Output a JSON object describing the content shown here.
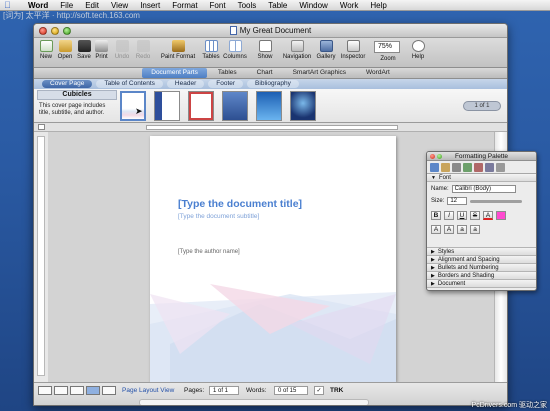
{
  "menubar": {
    "items": [
      "Word",
      "File",
      "Edit",
      "View",
      "Insert",
      "Format",
      "Font",
      "Tools",
      "Table",
      "Window",
      "Work",
      "Help"
    ]
  },
  "window": {
    "title": "My Great Document"
  },
  "toolbar": {
    "new": "New",
    "open": "Open",
    "save": "Save",
    "print": "Print",
    "undo": "Undo",
    "redo": "Redo",
    "paint_format": "Paint Format",
    "tables": "Tables",
    "columns": "Columns",
    "show": "Show",
    "navigation": "Navigation",
    "gallery": "Gallery",
    "inspector": "Inspector",
    "zoom": "Zoom",
    "zoom_value": "75%",
    "help": "Help"
  },
  "ribbon": {
    "tabs": [
      "Document Parts",
      "Tables",
      "Chart",
      "SmartArt Graphics",
      "WordArt"
    ],
    "active": 0
  },
  "gallery": {
    "tabs": [
      "Cover Page",
      "Table of Contents",
      "Header",
      "Footer",
      "Bibliography"
    ],
    "active": 0,
    "selected_title": "Cubicles",
    "selected_desc": "This cover page includes title, subtitle, and author.",
    "pager": "1 of 1"
  },
  "document": {
    "title_placeholder": "[Type the document title]",
    "subtitle_placeholder": "[Type the document subtitle]",
    "author_placeholder": "[Type the author name]"
  },
  "status": {
    "view": "Page Layout View",
    "pages_label": "Pages:",
    "pages_value": "1 of 1",
    "words_label": "Words:",
    "words_value": "0 of 15",
    "trk": "TRK"
  },
  "palette": {
    "title": "Formatting Palette",
    "font_section": "Font",
    "name_label": "Name:",
    "name_value": "Calibri (Body)",
    "size_label": "Size:",
    "size_value": "12",
    "sections": [
      "Styles",
      "Alignment and Spacing",
      "Bullets and Numbering",
      "Borders and Shading",
      "Document"
    ]
  },
  "overlays": {
    "top_watermark": "[词为] 太平洋  ·  http://soft.tech.163.com",
    "bottom_watermark": "PcDrivers.com 驱动之家"
  }
}
